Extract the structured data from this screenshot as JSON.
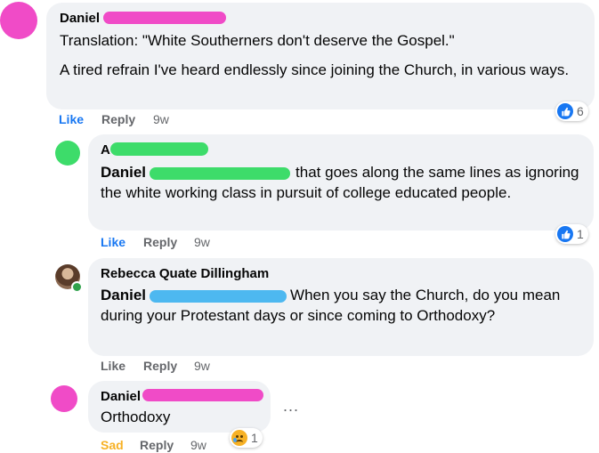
{
  "comments": [
    {
      "author": "Daniel",
      "author_color": "#f04bc7",
      "lines": [
        "Translation: \"White Southerners don't deserve the Gospel.\""
      ],
      "paragraph2": "A tired refrain I've heard endlessly since joining the Church, in various ways.",
      "actions": {
        "like": "Like",
        "reply": "Reply",
        "time": "9w"
      },
      "reaction_count": "6"
    },
    {
      "author": "A",
      "author_color": "#3ddc6a",
      "mention": "Daniel",
      "text": "that goes along the same lines as ignoring the white working class in pursuit of college educated people.",
      "actions": {
        "like": "Like",
        "reply": "Reply",
        "time": "9w"
      },
      "reaction_count": "1"
    },
    {
      "author": "Rebecca Quate Dillingham",
      "mention": "Daniel",
      "text": "When you say the Church, do you mean during your Protestant days or since coming to Orthodoxy?",
      "actions": {
        "like": "Like",
        "reply": "Reply",
        "time": "9w"
      }
    },
    {
      "author": "Daniel",
      "text": "Orthodoxy",
      "actions": {
        "like": "Sad",
        "reply": "Reply",
        "time": "9w"
      },
      "reaction_count": "1",
      "more": "..."
    }
  ],
  "colors": {
    "like_blue": "#1877f2",
    "sad_yellow": "#f7b125",
    "redact_pink": "#f04bc7",
    "redact_green": "#3ddc6a",
    "redact_blue": "#4db8f0"
  }
}
